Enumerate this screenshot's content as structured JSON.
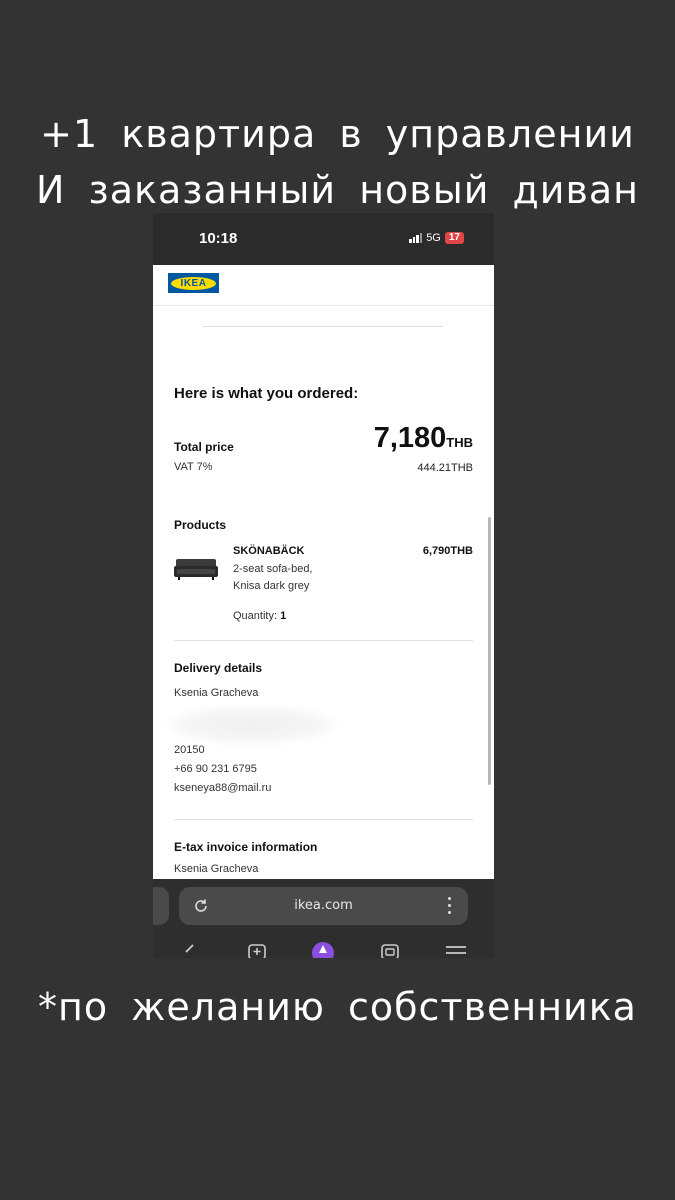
{
  "captions": {
    "top_line1": "+1 квартира в управлении",
    "top_line2": "И заказанный новый диван",
    "bottom": "*по желанию собственника"
  },
  "status_bar": {
    "time": "10:18",
    "network": "5G",
    "battery": "17"
  },
  "ikea": {
    "logo_text": "IKEA",
    "order_heading": "Here is what you ordered:",
    "total_label": "Total price",
    "total_amount": "7,180",
    "total_currency": "THB",
    "vat_label": "VAT 7%",
    "vat_amount": "444.21THB",
    "products_label": "Products",
    "product": {
      "name": "SKÖNABÄCK",
      "desc_line1": "2-seat sofa-bed,",
      "desc_line2": "Knisa dark grey",
      "price": "6,790THB",
      "quantity_label": "Quantity:",
      "quantity_value": "1"
    },
    "delivery": {
      "label": "Delivery details",
      "name": "Ksenia Gracheva",
      "postcode": "20150",
      "phone": "+66 90 231 6795",
      "email": "kseneya88@mail.ru"
    },
    "etax": {
      "label": "E-tax invoice information",
      "name": "Ksenia Gracheva"
    }
  },
  "browser": {
    "url": "ikea.com"
  },
  "colors": {
    "background": "#333333",
    "ikea_blue": "#0058a3",
    "ikea_yellow": "#ffdb00",
    "battery_red": "#e24545",
    "nav_purple": "#8a4fe0"
  },
  "icons": [
    "reload-icon",
    "more-vert-icon",
    "back-icon",
    "new-tab-icon",
    "assistant-icon",
    "tabs-icon",
    "hamburger-menu-icon"
  ]
}
